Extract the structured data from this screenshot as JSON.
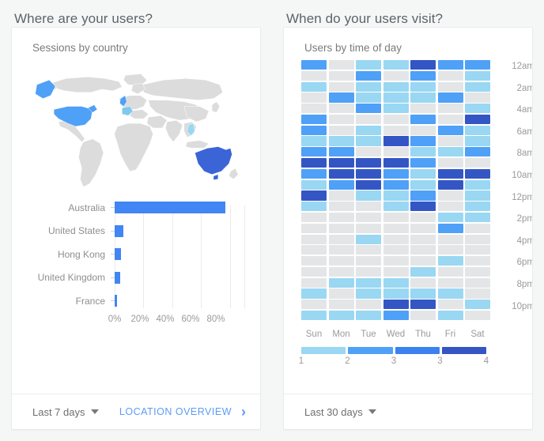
{
  "left": {
    "heading": "Where are your users?",
    "card_title": "Sessions by country",
    "footer": {
      "date_range": "Last 7 days",
      "link": "LOCATION OVERVIEW"
    },
    "map": {
      "highlights": [
        {
          "country": "Australia",
          "color": "#3b64d6"
        },
        {
          "country": "United States",
          "color": "#4fa0f7"
        },
        {
          "country": "United Kingdom",
          "color": "#4fa0f7"
        },
        {
          "country": "France",
          "color": "#7fc9ef"
        },
        {
          "country": "Hong Kong",
          "color": "#9ad7f2"
        }
      ],
      "base_color": "#dcdcdc"
    }
  },
  "right": {
    "heading": "When do your users visit?",
    "card_title": "Users by time of day",
    "footer": {
      "date_range": "Last 30 days"
    }
  },
  "chart_data": [
    {
      "type": "bar",
      "orientation": "horizontal",
      "title": "Sessions by country",
      "categories": [
        "Australia",
        "United States",
        "Hong Kong",
        "United Kingdom",
        "France"
      ],
      "values": [
        77,
        6,
        4.2,
        4,
        1.5
      ],
      "xlabel": "",
      "ylabel": "",
      "xlim": [
        0,
        90
      ],
      "xticks": [
        0,
        20,
        40,
        60,
        80
      ],
      "xticklabels": [
        "0%",
        "20%",
        "40%",
        "60%",
        "80%"
      ],
      "grid": true,
      "bar_color": "#4285f4",
      "legend": "none"
    },
    {
      "type": "heatmap",
      "title": "Users by time of day",
      "xlabel": "",
      "ylabel": "",
      "x": [
        "Sun",
        "Mon",
        "Tue",
        "Wed",
        "Thu",
        "Fri",
        "Sat"
      ],
      "y": [
        "12am",
        "1am",
        "2am",
        "3am",
        "4am",
        "5am",
        "6am",
        "7am",
        "8am",
        "9am",
        "10am",
        "11am",
        "12pm",
        "1pm",
        "2pm",
        "3pm",
        "4pm",
        "5pm",
        "6pm",
        "7pm",
        "8pm",
        "9pm",
        "10pm",
        "11pm"
      ],
      "y_ticklabels_shown": [
        "12am",
        "2am",
        "4am",
        "6am",
        "8am",
        "10am",
        "12pm",
        "2pm",
        "4pm",
        "6pm",
        "8pm",
        "10pm"
      ],
      "colorscale": [
        "#e4e5e7",
        "#9ad7f2",
        "#4fa0f7",
        "#3b82f0",
        "#3456c4"
      ],
      "legend": {
        "position": "bottom",
        "swatches": [
          "#9ad7f2",
          "#4fa0f7",
          "#3b82f0",
          "#3456c4"
        ],
        "labels": [
          "1",
          "2",
          "3",
          "3",
          "4"
        ]
      },
      "values": [
        [
          2,
          0,
          1,
          1,
          4,
          2,
          2
        ],
        [
          0,
          0,
          2,
          0,
          2,
          0,
          1
        ],
        [
          1,
          0,
          1,
          1,
          1,
          0,
          1
        ],
        [
          0,
          2,
          1,
          1,
          1,
          2,
          0
        ],
        [
          0,
          0,
          2,
          1,
          0,
          0,
          1
        ],
        [
          2,
          0,
          0,
          0,
          2,
          0,
          4
        ],
        [
          2,
          0,
          1,
          0,
          0,
          2,
          1
        ],
        [
          1,
          1,
          1,
          4,
          2,
          0,
          1
        ],
        [
          2,
          2,
          0,
          0,
          1,
          1,
          2
        ],
        [
          4,
          4,
          4,
          4,
          2,
          0,
          0
        ],
        [
          2,
          4,
          4,
          2,
          1,
          4,
          4
        ],
        [
          1,
          2,
          4,
          2,
          1,
          4,
          1
        ],
        [
          4,
          0,
          1,
          1,
          2,
          0,
          1
        ],
        [
          1,
          0,
          0,
          1,
          4,
          0,
          1
        ],
        [
          0,
          0,
          0,
          0,
          0,
          1,
          1
        ],
        [
          0,
          0,
          0,
          0,
          0,
          2,
          0
        ],
        [
          0,
          0,
          1,
          0,
          0,
          0,
          0
        ],
        [
          0,
          0,
          0,
          0,
          0,
          0,
          0
        ],
        [
          0,
          0,
          0,
          0,
          0,
          1,
          0
        ],
        [
          0,
          0,
          0,
          0,
          1,
          0,
          0
        ],
        [
          0,
          1,
          1,
          1,
          0,
          0,
          0
        ],
        [
          1,
          0,
          1,
          1,
          1,
          1,
          0
        ],
        [
          0,
          0,
          0,
          4,
          4,
          0,
          1
        ],
        [
          1,
          1,
          1,
          2,
          0,
          1,
          0
        ]
      ]
    }
  ]
}
